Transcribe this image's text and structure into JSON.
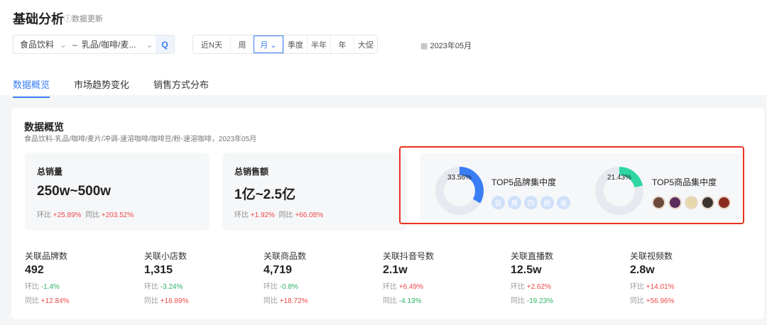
{
  "header": {
    "title": "基础分析",
    "update": "ⓘ数据更新"
  },
  "filter": {
    "category1": "食品饮料",
    "category2": "乳品/咖啡/麦...",
    "search_icon": "Q"
  },
  "periods": [
    "近N天",
    "周",
    "月 ⌄",
    "季度",
    "半年",
    "年",
    "大促"
  ],
  "date": "2023年05月",
  "tabs": [
    "数据概览",
    "市场趋势变化",
    "销售方式分布"
  ],
  "overview": {
    "title": "数据概览",
    "subtitle": "食品饮料-乳品/咖啡/麦片/冲调-速溶咖啡/咖啡豆/粉-速溶咖啡，2023年05月",
    "sales": {
      "label": "总销量",
      "value": "250w~500w",
      "mom_label": "环比",
      "mom": "+25.89%",
      "yoy_label": "同比",
      "yoy": "+203.52%"
    },
    "amount": {
      "label": "总销售额",
      "value": "1亿~2.5亿",
      "mom_label": "环比",
      "mom": "+1.92%",
      "yoy_label": "同比",
      "yoy": "+66.08%"
    },
    "brand": {
      "label": "TOP5品牌集中度",
      "percent": "33.56%",
      "fraction": 0.3356,
      "color": "#3a7ef6",
      "icons": [
        "尝",
        "奥",
        "四",
        "她",
        "雀"
      ]
    },
    "product": {
      "label": "TOP5商品集中度",
      "percent": "21.43%",
      "fraction": 0.2143,
      "color": "#2fd6a3"
    }
  },
  "stats": [
    {
      "label": "关联品牌数",
      "value": "492",
      "mom": "-1.4%",
      "yoy": "+12.84%"
    },
    {
      "label": "关联小店数",
      "value": "1,315",
      "mom": "-3.24%",
      "yoy": "+16.89%"
    },
    {
      "label": "关联商品数",
      "value": "4,719",
      "mom": "-0.8%",
      "yoy": "+18.72%"
    },
    {
      "label": "关联抖音号数",
      "value": "2.1w",
      "mom": "+6.49%",
      "yoy": "-4.13%"
    },
    {
      "label": "关联直播数",
      "value": "12.5w",
      "mom": "+2.62%",
      "yoy": "-19.23%"
    },
    {
      "label": "关联视频数",
      "value": "2.8w",
      "mom": "+14.01%",
      "yoy": "+56.96%"
    }
  ],
  "mom_label": "环比",
  "yoy_label": "同比"
}
